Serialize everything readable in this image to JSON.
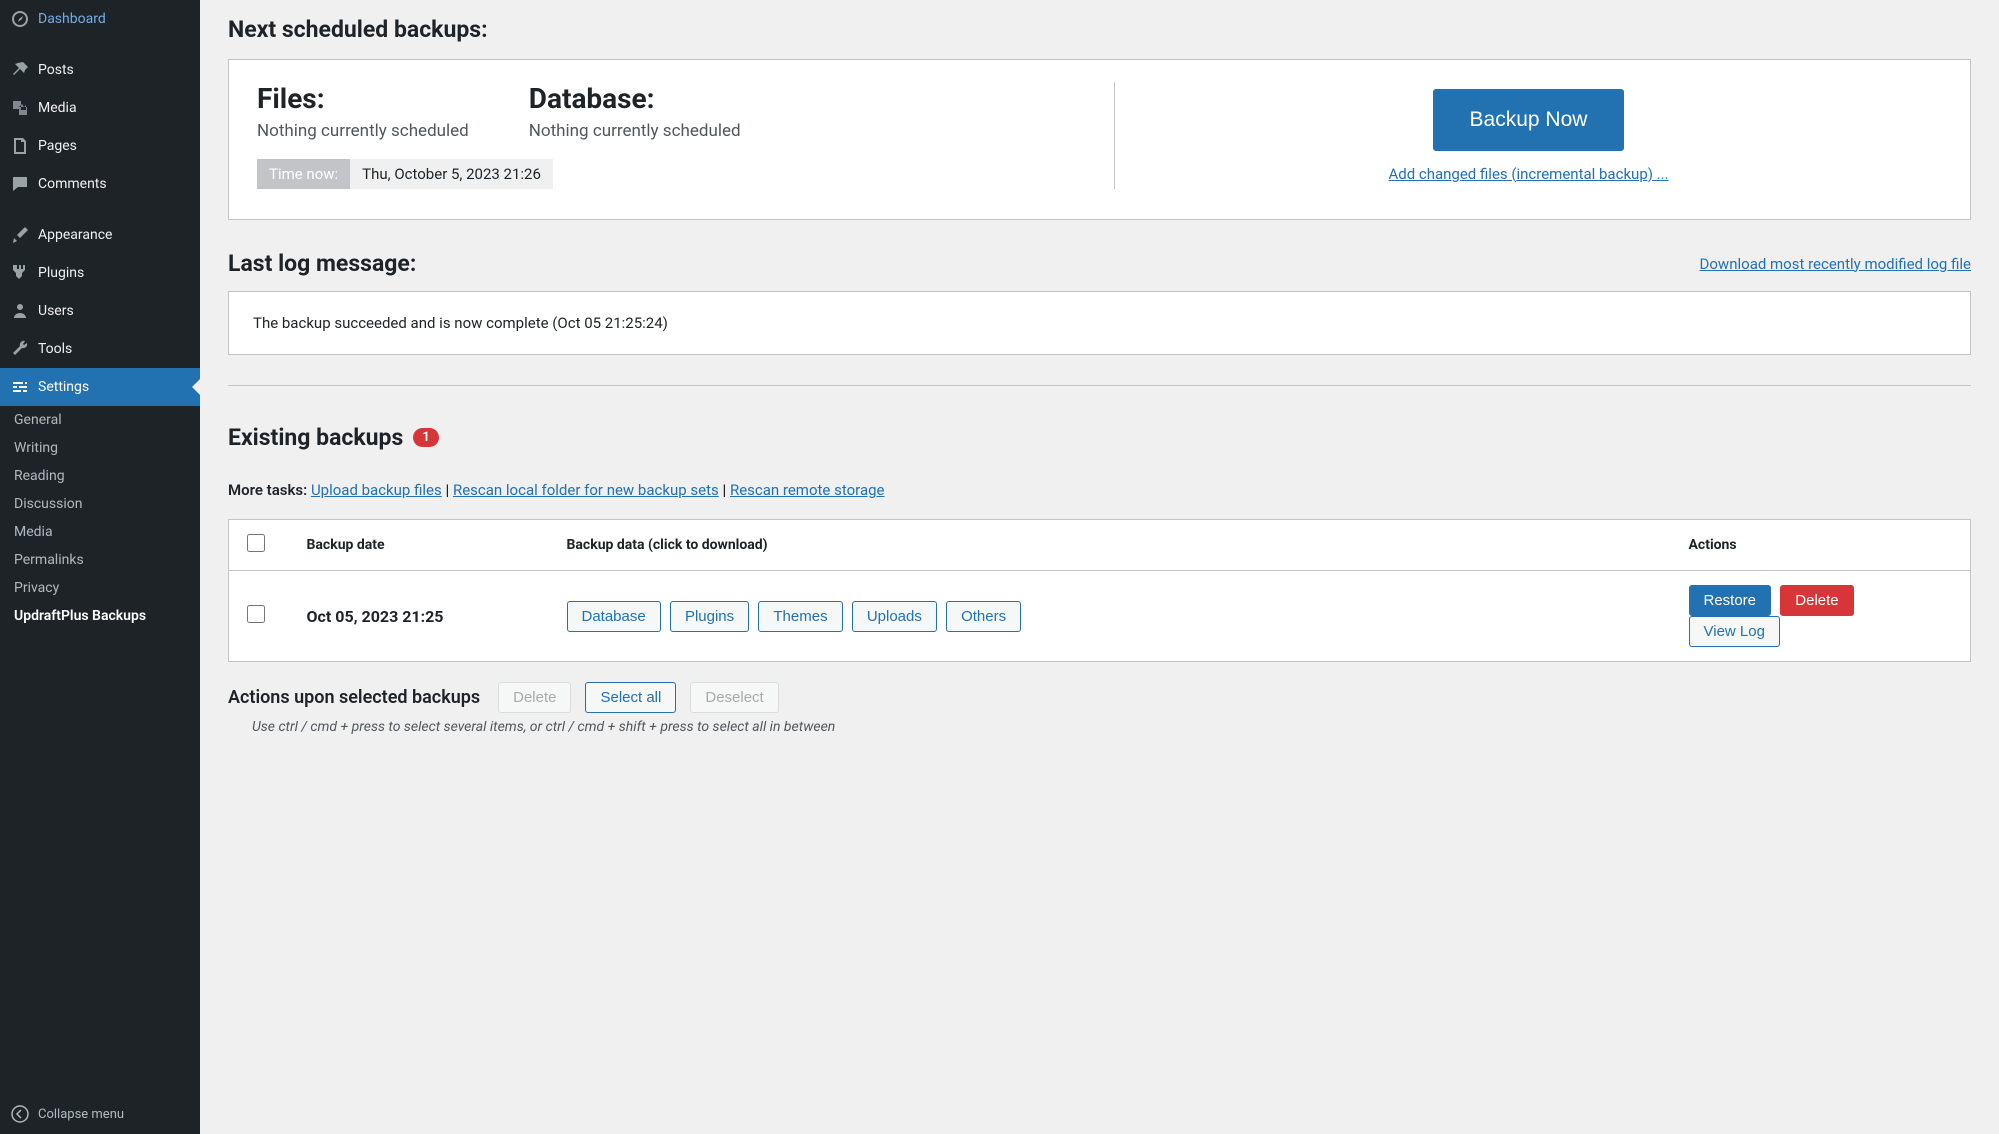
{
  "sidebar": {
    "items": [
      {
        "label": "Dashboard"
      },
      {
        "label": "Posts"
      },
      {
        "label": "Media"
      },
      {
        "label": "Pages"
      },
      {
        "label": "Comments"
      },
      {
        "label": "Appearance"
      },
      {
        "label": "Plugins"
      },
      {
        "label": "Users"
      },
      {
        "label": "Tools"
      },
      {
        "label": "Settings"
      }
    ],
    "submenu": [
      {
        "label": "General"
      },
      {
        "label": "Writing"
      },
      {
        "label": "Reading"
      },
      {
        "label": "Discussion"
      },
      {
        "label": "Media"
      },
      {
        "label": "Permalinks"
      },
      {
        "label": "Privacy"
      },
      {
        "label": "UpdraftPlus Backups"
      }
    ],
    "collapse": "Collapse menu"
  },
  "scheduled": {
    "heading": "Next scheduled backups:",
    "files_label": "Files:",
    "files_value": "Nothing currently scheduled",
    "db_label": "Database:",
    "db_value": "Nothing currently scheduled",
    "time_now_label": "Time now:",
    "time_now_value": "Thu, October 5, 2023 21:26",
    "backup_now": "Backup Now",
    "incremental_link": "Add changed files (incremental backup) ..."
  },
  "log": {
    "heading": "Last log message:",
    "download_link": "Download most recently modified log file",
    "message": "The backup succeeded and is now complete (Oct 05 21:25:24)"
  },
  "existing": {
    "heading": "Existing backups",
    "count": "1",
    "more_tasks_label": "More tasks:",
    "upload_link": "Upload backup files",
    "rescan_local_link": "Rescan local folder for new backup sets",
    "rescan_remote_link": "Rescan remote storage",
    "table": {
      "col_date": "Backup date",
      "col_data": "Backup data (click to download)",
      "col_actions": "Actions",
      "rows": [
        {
          "date": "Oct 05, 2023 21:25",
          "components": [
            "Database",
            "Plugins",
            "Themes",
            "Uploads",
            "Others"
          ],
          "actions": {
            "restore": "Restore",
            "delete": "Delete",
            "view_log": "View Log"
          }
        }
      ]
    },
    "selected_actions": {
      "label": "Actions upon selected backups",
      "delete": "Delete",
      "select_all": "Select all",
      "deselect": "Deselect",
      "hint": "Use ctrl / cmd + press to select several items, or ctrl / cmd + shift + press to select all in between"
    }
  }
}
